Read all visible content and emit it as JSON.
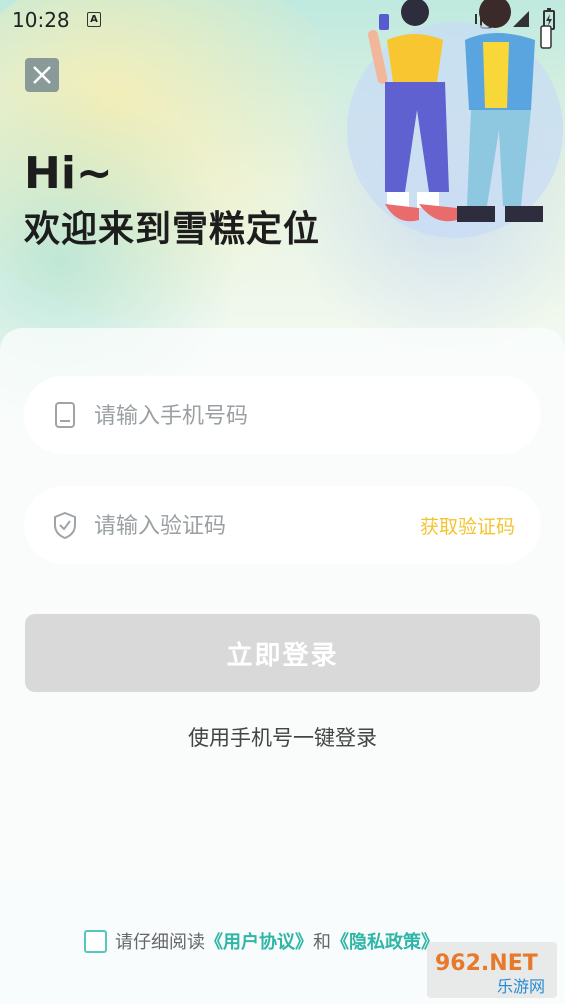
{
  "status_bar": {
    "time": "10:28",
    "indicator": "A"
  },
  "header": {
    "greeting": "Hi~",
    "welcome": "欢迎来到雪糕定位"
  },
  "form": {
    "phone_placeholder": "请输入手机号码",
    "code_placeholder": "请输入验证码",
    "get_code_label": "获取验证码",
    "login_label": "立即登录",
    "one_key_login": "使用手机号一键登录"
  },
  "agreement": {
    "prefix": "请仔细阅读",
    "user_agreement": "《用户协议》",
    "and": "和",
    "privacy_policy": "《隐私政策》"
  },
  "watermark": {
    "top": "962.NET",
    "bottom": "乐游网"
  },
  "colors": {
    "accent": "#f4c430",
    "link": "#2fb6a6",
    "button_disabled": "#d9d9d9"
  }
}
